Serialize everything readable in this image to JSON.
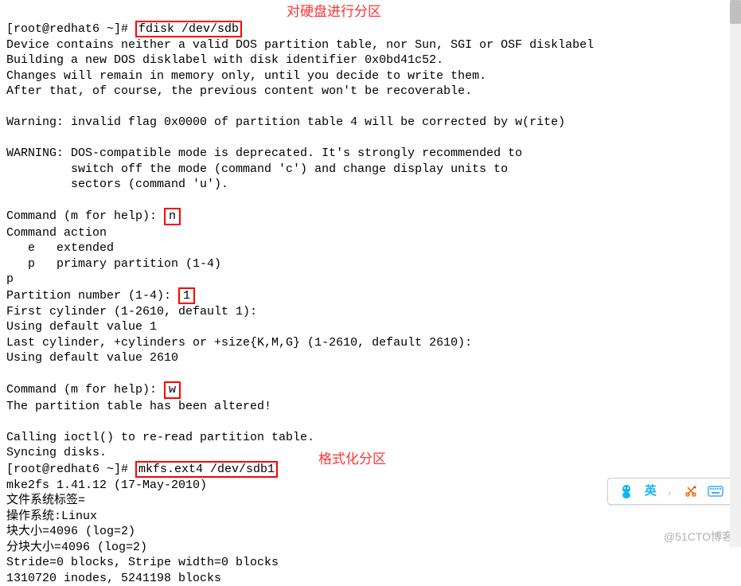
{
  "prompt1": "[root@redhat6 ~]# ",
  "cmd1": "fdisk /dev/sdb",
  "annot1": "对硬盘进行分区",
  "line2": "Device contains neither a valid DOS partition table, nor Sun, SGI or OSF disklabel",
  "line3": "Building a new DOS disklabel with disk identifier 0x0bd41c52.",
  "line4": "Changes will remain in memory only, until you decide to write them.",
  "line5": "After that, of course, the previous content won't be recoverable.",
  "line6": "",
  "line7": "Warning: invalid flag 0x0000 of partition table 4 will be corrected by w(rite)",
  "line8": "",
  "line9": "WARNING: DOS-compatible mode is deprecated. It's strongly recommended to",
  "line10": "         switch off the mode (command 'c') and change display units to",
  "line11": "         sectors (command 'u').",
  "line12": "",
  "line13_pre": "Command (m for help): ",
  "line13_box": "n",
  "line14": "Command action",
  "line15": "   e   extended",
  "line16": "   p   primary partition (1-4)",
  "line17": "p",
  "line18_pre": "Partition number (1-4): ",
  "line18_box": "1",
  "line19": "First cylinder (1-2610, default 1):",
  "line20": "Using default value 1",
  "line21": "Last cylinder, +cylinders or +size{K,M,G} (1-2610, default 2610):",
  "line22": "Using default value 2610",
  "line23": "",
  "line24_pre": "Command (m for help): ",
  "line24_box": "w",
  "line25": "The partition table has been altered!",
  "line26": "",
  "line27": "Calling ioctl() to re-read partition table.",
  "line28": "Syncing disks.",
  "prompt2": "[root@redhat6 ~]# ",
  "cmd2": "mkfs.ext4 /dev/sdb1",
  "annot2": "格式化分区",
  "line30": "mke2fs 1.41.12 (17-May-2010)",
  "line31": "文件系统标签=",
  "line32": "操作系统:Linux",
  "line33": "块大小=4096 (log=2)",
  "line34": "分块大小=4096 (log=2)",
  "line35": "Stride=0 blocks, Stripe width=0 blocks",
  "line36": "1310720 inodes, 5241198 blocks",
  "ime_label": "英",
  "watermark": "@51CTO博客"
}
